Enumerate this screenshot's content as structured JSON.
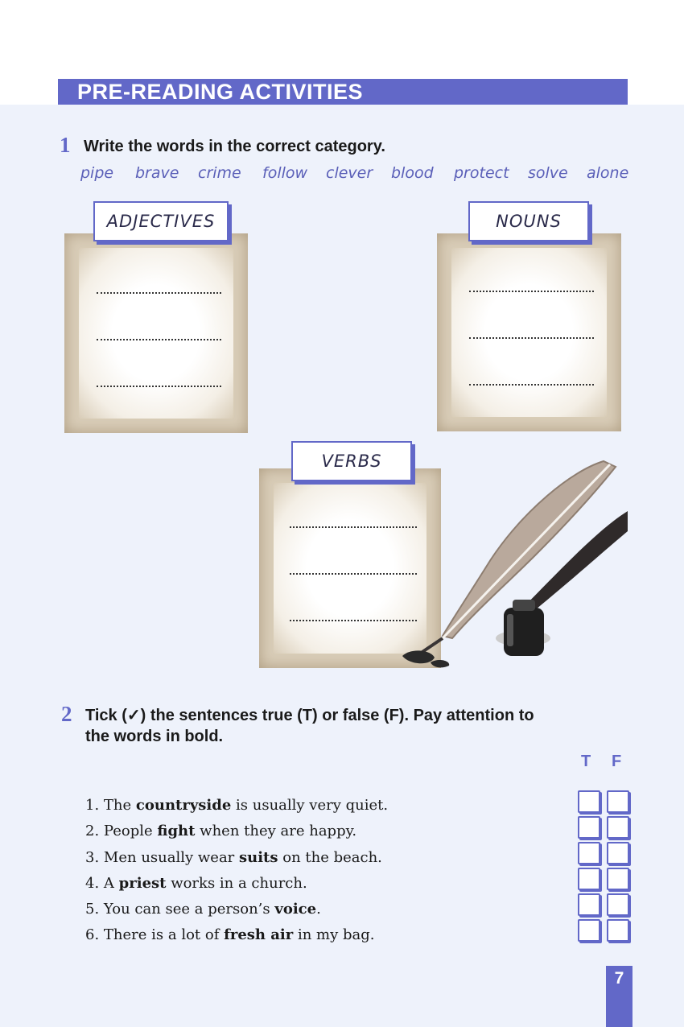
{
  "header": {
    "title": "PRE-READING ACTIVITIES"
  },
  "exercise1": {
    "number": "1",
    "instruction": "Write the words in the correct category.",
    "words": [
      "pipe",
      "brave",
      "crime",
      "follow",
      "clever",
      "blood",
      "protect",
      "solve",
      "alone"
    ],
    "categories": {
      "adjectives": "ADJECTIVES",
      "nouns": "NOUNS",
      "verbs": "VERBS"
    }
  },
  "exercise2": {
    "number": "2",
    "instruction_line1": "Tick (✓) the sentences true (T) or false (F). Pay attention to",
    "instruction_line2": "the words in bold.",
    "true_label": "T",
    "false_label": "F",
    "sentences": [
      {
        "num": "1.",
        "pre": "The ",
        "bold": "countryside",
        "post": " is usually very quiet."
      },
      {
        "num": "2.",
        "pre": "People ",
        "bold": "fight",
        "post": " when they are happy."
      },
      {
        "num": "3.",
        "pre": "Men usually wear ",
        "bold": "suits",
        "post": " on the beach."
      },
      {
        "num": "4.",
        "pre": "A ",
        "bold": "priest",
        "post": " works in a church."
      },
      {
        "num": "5.",
        "pre": "You can see a person’s ",
        "bold": "voice",
        "post": "."
      },
      {
        "num": "6.",
        "pre": "There is a lot of ",
        "bold": "fresh air",
        "post": " in my bag."
      }
    ]
  },
  "page_number": "7",
  "colors": {
    "accent": "#6268c8",
    "page_background": "#eef2fb",
    "paper": "#d9cdb8"
  },
  "icons": {
    "illustration": "quill-and-inkwell-icon",
    "checkbox": "checkbox-icon"
  }
}
